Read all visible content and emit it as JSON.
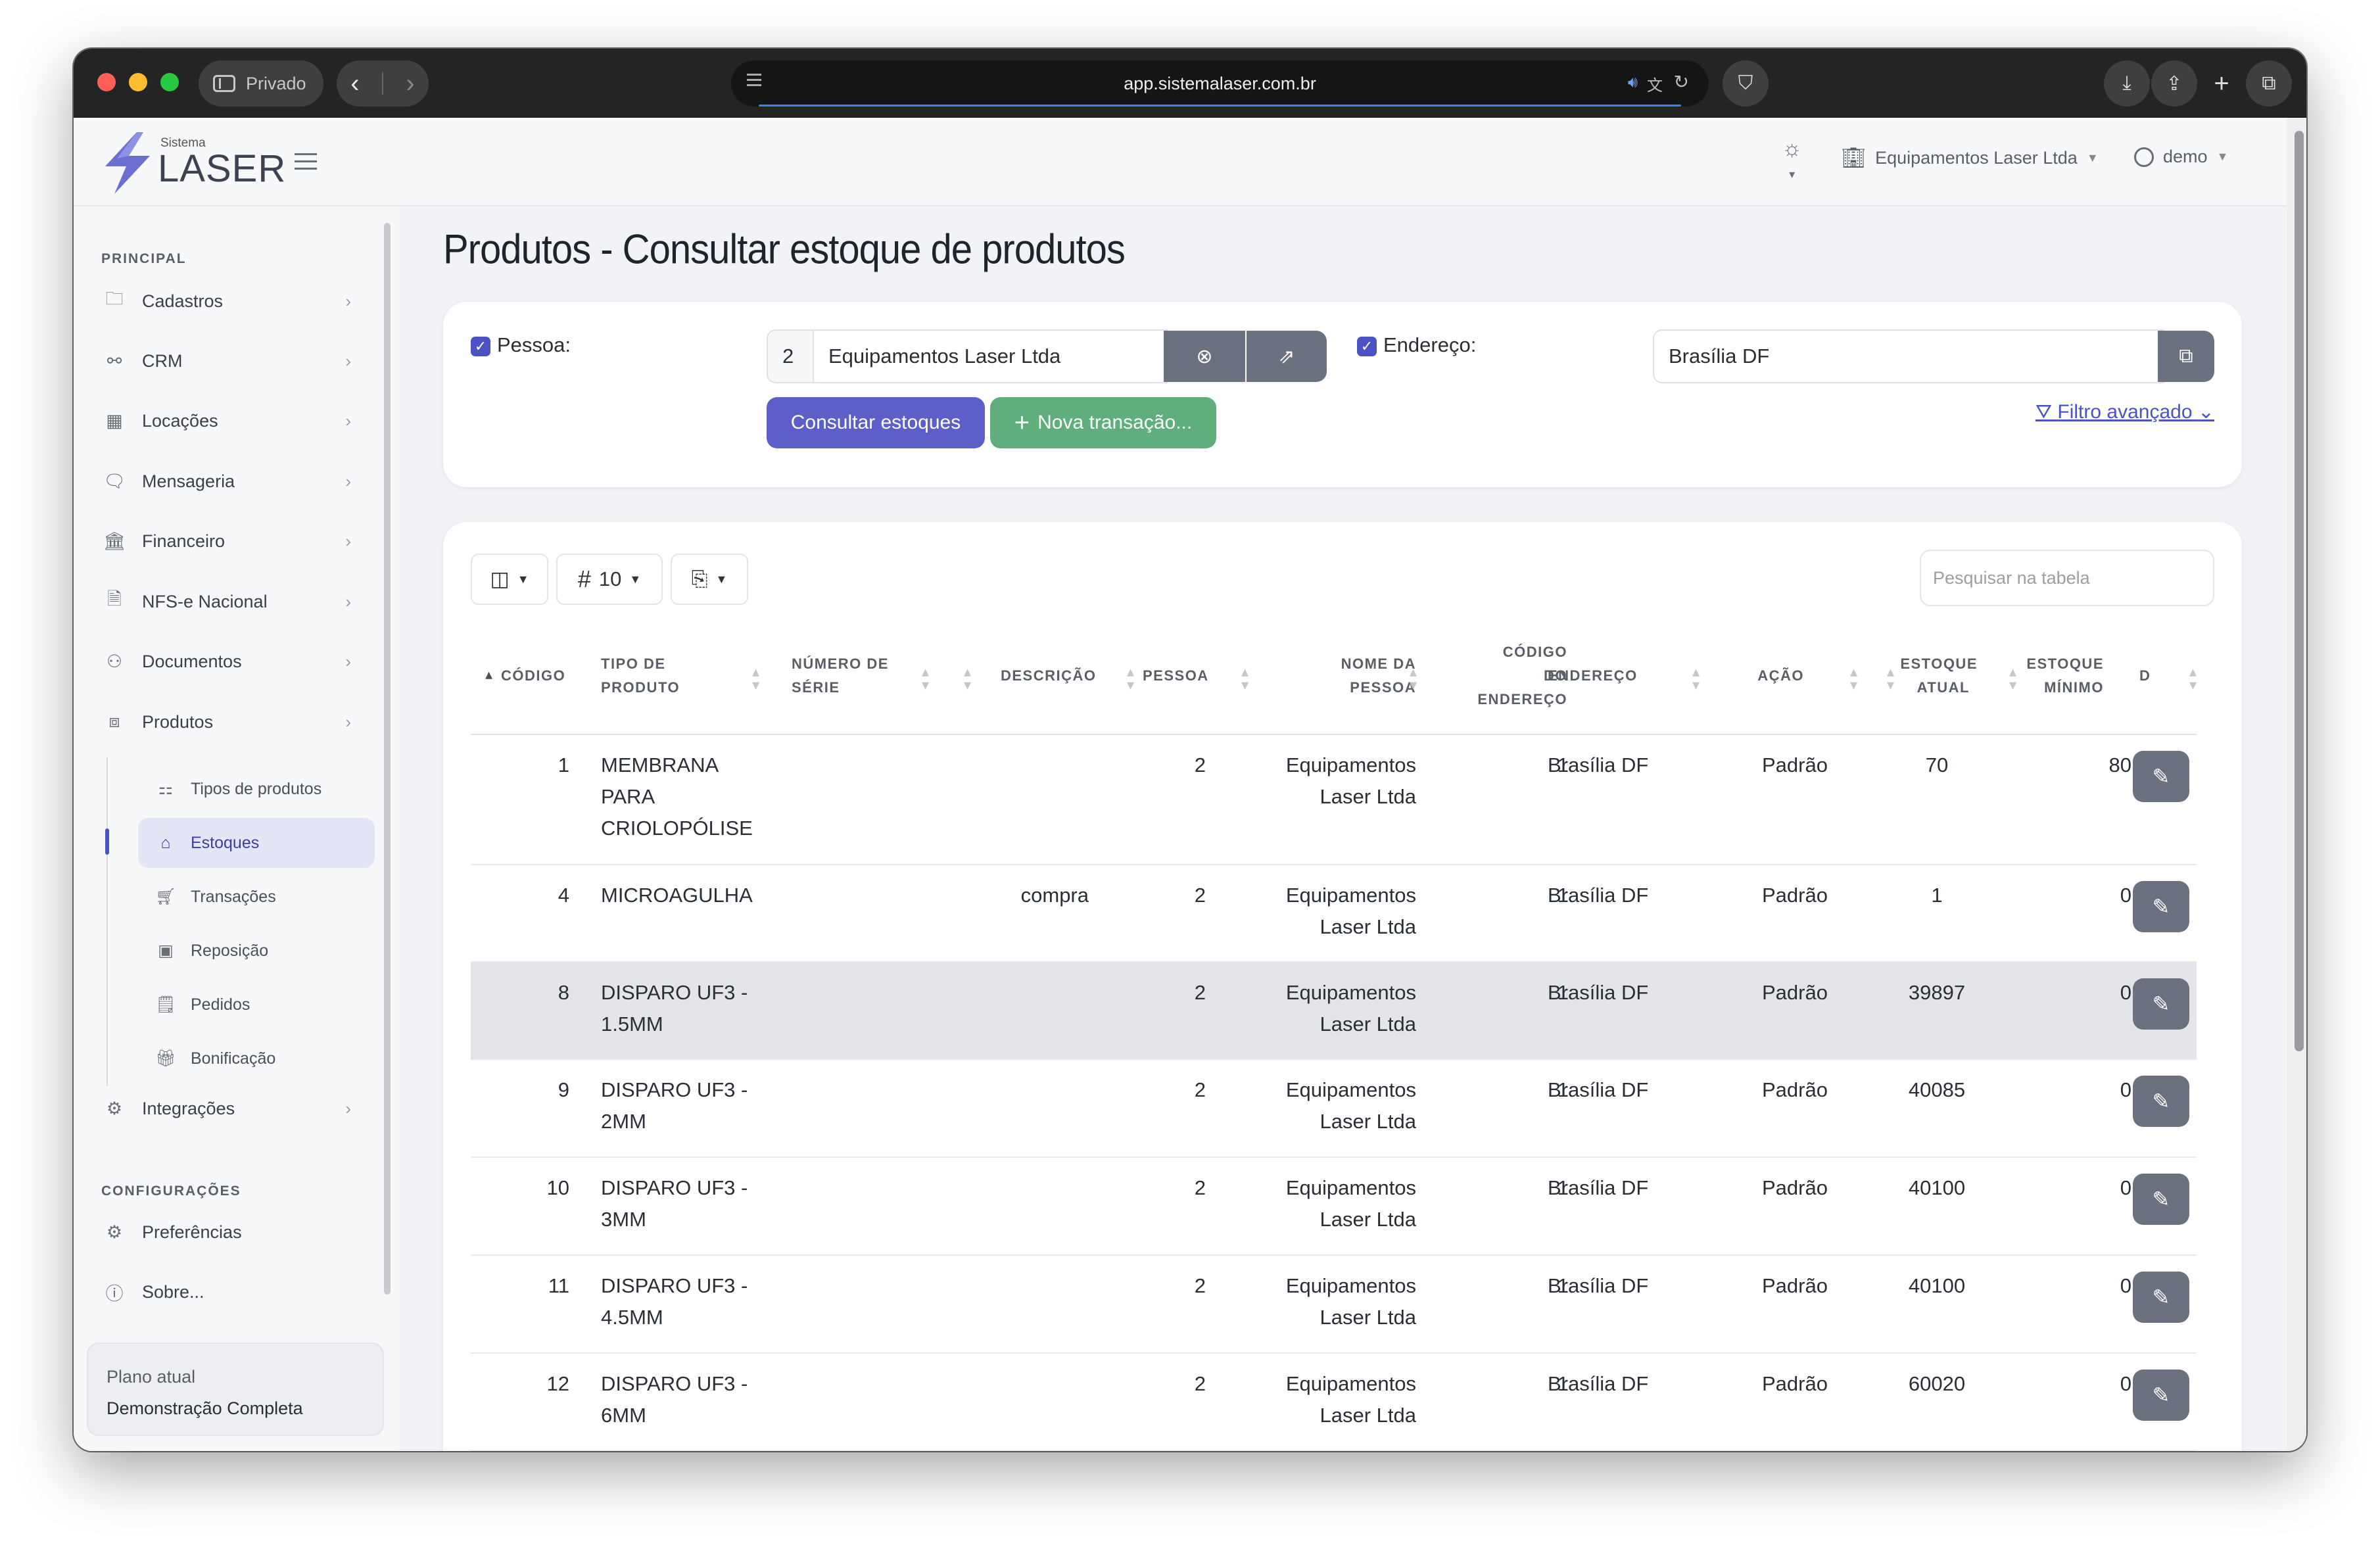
{
  "browser": {
    "private_label": "Privado",
    "url": "app.sistemalaser.com.br"
  },
  "header": {
    "logo_small": "Sistema",
    "logo_big": "LASER",
    "company": "Equipamentos Laser Ltda",
    "user": "demo"
  },
  "sidebar": {
    "principal_title": "PRINCIPAL",
    "items": [
      {
        "label": "Cadastros",
        "icon": "folder-icon"
      },
      {
        "label": "CRM",
        "icon": "share-icon"
      },
      {
        "label": "Locações",
        "icon": "calendar-icon"
      },
      {
        "label": "Mensageria",
        "icon": "chat-icon"
      },
      {
        "label": "Financeiro",
        "icon": "finance-icon"
      },
      {
        "label": "NFS-e Nacional",
        "icon": "tax-icon"
      },
      {
        "label": "Documentos",
        "icon": "documents-icon"
      },
      {
        "label": "Produtos",
        "icon": "box-icon"
      }
    ],
    "subitems": [
      {
        "label": "Tipos de produtos"
      },
      {
        "label": "Estoques",
        "active": true
      },
      {
        "label": "Transações"
      },
      {
        "label": "Reposição"
      },
      {
        "label": "Pedidos"
      },
      {
        "label": "Bonificação"
      }
    ],
    "integracoes": "Integrações",
    "config_title": "CONFIGURAÇÕES",
    "preferencias": "Preferências",
    "sobre": "Sobre...",
    "plan_label": "Plano atual",
    "plan_value": "Demonstração Completa"
  },
  "page": {
    "title": "Produtos - Consultar estoque de produtos"
  },
  "filter": {
    "pessoa_label": "Pessoa:",
    "pessoa_id": "2",
    "pessoa_name": "Equipamentos Laser Ltda",
    "endereco_label": "Endereço:",
    "endereco_value": "Brasília DF",
    "consultar": "Consultar estoques",
    "nova": "Nova transação...",
    "filtro_avancado": "Filtro avançado"
  },
  "table": {
    "page_size": "10",
    "search_placeholder": "Pesquisar na tabela",
    "headers": {
      "codigo": "CÓDIGO",
      "tipo_1": "TIPO DE",
      "tipo_2": "PRODUTO",
      "serie_1": "NÚMERO DE",
      "serie_2": "SÉRIE",
      "descricao": "DESCRIÇÃO",
      "pessoa": "PESSOA",
      "nome_1": "NOME DA",
      "nome_2": "PESSOA",
      "codend_1": "CÓDIGO",
      "codend_2": "DO",
      "codend_3": "ENDEREÇO",
      "endereco": "ENDEREÇO",
      "acao": "AÇÃO",
      "atual_1": "ESTOQUE",
      "atual_2": "ATUAL",
      "minimo_1": "ESTOQUE",
      "minimo_2": "MÍNIMO",
      "d": "D"
    },
    "rows": [
      {
        "codigo": "1",
        "tipo": [
          "MEMBRANA",
          "PARA",
          "CRIOLOPÓLISE"
        ],
        "descricao": "",
        "pessoa": "2",
        "nome": [
          "Equipamentos",
          "Laser Ltda"
        ],
        "cod_end": "1",
        "endereco": "Brasília DF",
        "acao": "Padrão",
        "atual": "70",
        "minimo": "80"
      },
      {
        "codigo": "4",
        "tipo": [
          "MICROAGULHA"
        ],
        "descricao": "compra",
        "pessoa": "2",
        "nome": [
          "Equipamentos",
          "Laser Ltda"
        ],
        "cod_end": "1",
        "endereco": "Brasília DF",
        "acao": "Padrão",
        "atual": "1",
        "minimo": "0"
      },
      {
        "codigo": "8",
        "tipo": [
          "DISPARO UF3 -",
          "1.5MM"
        ],
        "descricao": "",
        "pessoa": "2",
        "nome": [
          "Equipamentos",
          "Laser Ltda"
        ],
        "cod_end": "1",
        "endereco": "Brasília DF",
        "acao": "Padrão",
        "atual": "39897",
        "minimo": "0"
      },
      {
        "codigo": "9",
        "tipo": [
          "DISPARO UF3 -",
          "2MM"
        ],
        "descricao": "",
        "pessoa": "2",
        "nome": [
          "Equipamentos",
          "Laser Ltda"
        ],
        "cod_end": "1",
        "endereco": "Brasília DF",
        "acao": "Padrão",
        "atual": "40085",
        "minimo": "0"
      },
      {
        "codigo": "10",
        "tipo": [
          "DISPARO UF3 -",
          "3MM"
        ],
        "descricao": "",
        "pessoa": "2",
        "nome": [
          "Equipamentos",
          "Laser Ltda"
        ],
        "cod_end": "1",
        "endereco": "Brasília DF",
        "acao": "Padrão",
        "atual": "40100",
        "minimo": "0"
      },
      {
        "codigo": "11",
        "tipo": [
          "DISPARO UF3 -",
          "4.5MM"
        ],
        "descricao": "",
        "pessoa": "2",
        "nome": [
          "Equipamentos",
          "Laser Ltda"
        ],
        "cod_end": "1",
        "endereco": "Brasília DF",
        "acao": "Padrão",
        "atual": "40100",
        "minimo": "0"
      },
      {
        "codigo": "12",
        "tipo": [
          "DISPARO UF3 -",
          "6MM"
        ],
        "descricao": "",
        "pessoa": "2",
        "nome": [
          "Equipamentos",
          "Laser Ltda"
        ],
        "cod_end": "1",
        "endereco": "Brasília DF",
        "acao": "Padrão",
        "atual": "60020",
        "minimo": "0"
      }
    ]
  },
  "colors": {
    "primary": "#5b5fc7",
    "success": "#5fae7b",
    "secondary": "#6c7180"
  }
}
